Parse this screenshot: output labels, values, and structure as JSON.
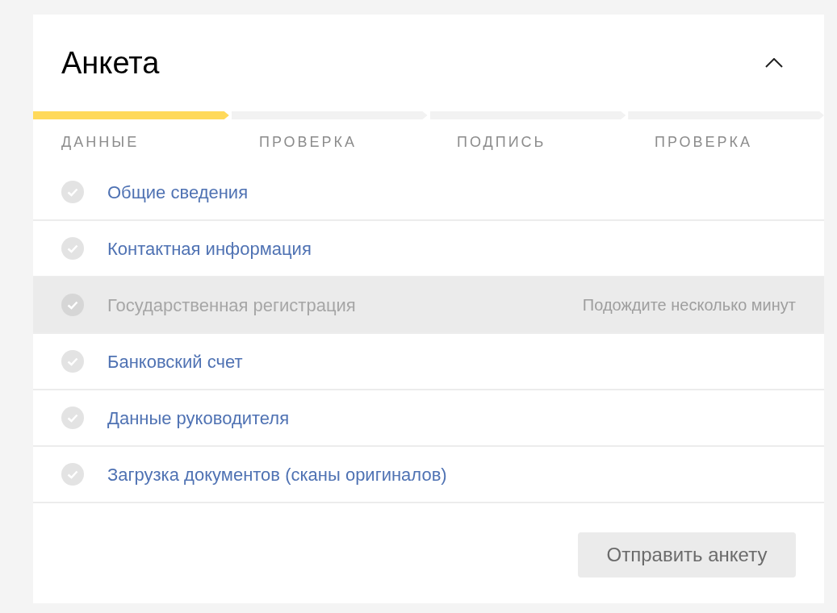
{
  "title": "Анкета",
  "steps": [
    {
      "label": "ДАННЫЕ",
      "active": true
    },
    {
      "label": "ПРОВЕРКА",
      "active": false
    },
    {
      "label": "ПОДПИСЬ",
      "active": false
    },
    {
      "label": "ПРОВЕРКА",
      "active": false
    }
  ],
  "sections": [
    {
      "label": "Общие сведения",
      "disabled": false
    },
    {
      "label": "Контактная информация",
      "disabled": false
    },
    {
      "label": "Государственная регистрация",
      "disabled": true,
      "note": "Подождите несколько минут"
    },
    {
      "label": "Банковский счет",
      "disabled": false
    },
    {
      "label": "Данные руководителя",
      "disabled": false
    },
    {
      "label": "Загрузка документов (сканы оригиналов)",
      "disabled": false
    }
  ],
  "submit_button": "Отправить анкету"
}
